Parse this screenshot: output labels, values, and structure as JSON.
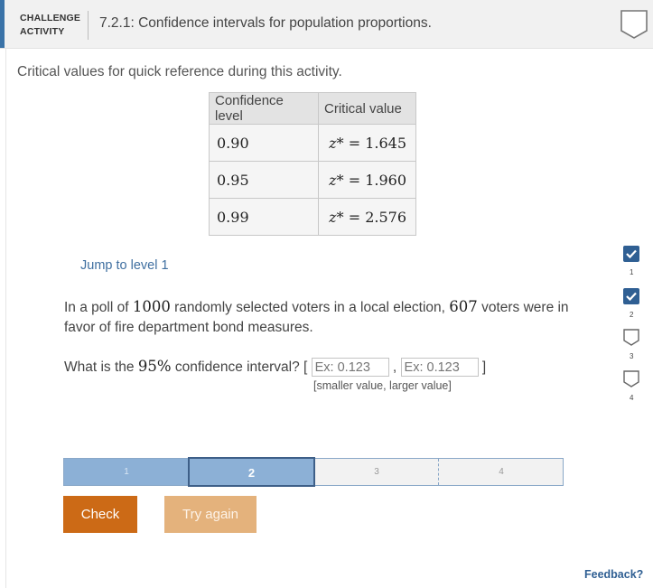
{
  "header": {
    "tag_line1": "CHALLENGE",
    "tag_line2": "ACTIVITY",
    "title": "7.2.1: Confidence intervals for population proportions."
  },
  "intro": "Critical values for quick reference during this activity.",
  "critical_table": {
    "headers": [
      "Confidence level",
      "Critical value"
    ],
    "rows": [
      {
        "level": "0.90",
        "z": "z*",
        "eq": " = ",
        "value": "1.645"
      },
      {
        "level": "0.95",
        "z": "z*",
        "eq": " = ",
        "value": "1.960"
      },
      {
        "level": "0.99",
        "z": "z*",
        "eq": " = ",
        "value": "2.576"
      }
    ]
  },
  "jump_link": "Jump to level 1",
  "problem": {
    "p1": "In a poll of ",
    "n": "1000",
    "p2": " randomly selected voters in a local election, ",
    "x": "607",
    "p3": " voters were in favor of fire department bond measures."
  },
  "question": {
    "q1": "What is the ",
    "pct": "95%",
    "q2": " confidence interval? [ ",
    "comma": " , ",
    "close": " ]",
    "input1_placeholder": "Ex: 0.123",
    "input2_placeholder": "Ex: 0.123",
    "note": "[smaller value, larger value]"
  },
  "progress": {
    "segments": [
      "1",
      "2",
      "3",
      "4"
    ],
    "current": 2
  },
  "buttons": {
    "check": "Check",
    "try_again": "Try again"
  },
  "feedback": "Feedback?",
  "levels": [
    {
      "number": "1",
      "completed": true
    },
    {
      "number": "2",
      "completed": true
    },
    {
      "number": "3",
      "completed": false
    },
    {
      "number": "4",
      "completed": false
    }
  ],
  "colors": {
    "accent": "#3a73a8",
    "check_button": "#cc6a16",
    "try_again_button": "#e4b27c",
    "progress_fill": "#8cb0d6",
    "level_complete": "#2f5f93"
  }
}
